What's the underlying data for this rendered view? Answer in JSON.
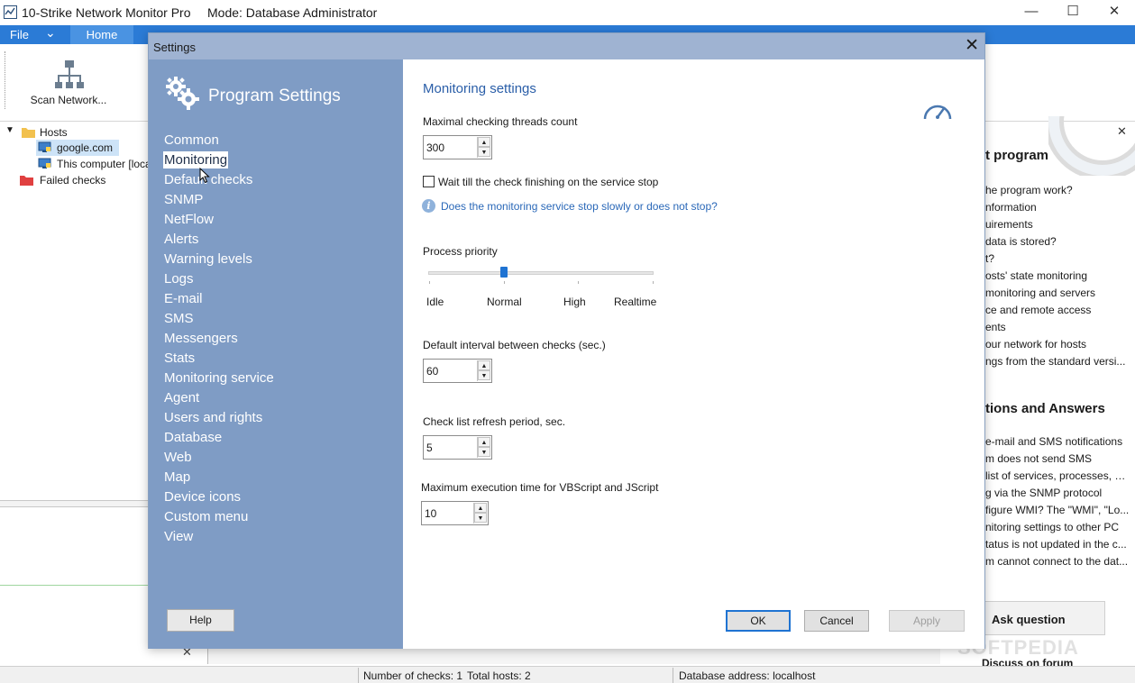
{
  "window": {
    "title": "10-Strike Network Monitor Pro",
    "mode": "Mode: Database Administrator",
    "controls": {
      "minimize": "—",
      "maximize": "☐",
      "close": "✕"
    }
  },
  "menu": {
    "file": "File",
    "dropdown": "⌄",
    "home": "Home"
  },
  "ribbon": {
    "scan_label": "Scan Network..."
  },
  "tree": {
    "root": "Hosts",
    "items": [
      "google.com",
      "This computer [loca",
      "Failed checks"
    ]
  },
  "status": {
    "checks": "Number of checks: 1",
    "hosts": "Total hosts: 2",
    "db": "Database address: localhost"
  },
  "help_panel": {
    "heading1": "t program",
    "links1": [
      "he program work?",
      "nformation",
      "uirements",
      "data is stored?",
      "t?",
      "osts' state monitoring",
      "monitoring and servers",
      "ce and remote access",
      "ents",
      "our network for hosts",
      "ngs from the standard versi..."
    ],
    "heading2": "tions and Answers",
    "links2": [
      "e-mail and SMS notifications",
      "m does not send SMS",
      " list of services, processes, a...",
      "g via the SNMP protocol",
      "figure WMI? The \"WMI\", \"Lo...",
      "nitoring settings to other PC",
      "tatus is not updated in the c...",
      "m cannot connect to the dat..."
    ],
    "ask_button": "Ask question",
    "discuss": "Discuss on forum",
    "close": "✕"
  },
  "watermark": "SOFTPEDIA",
  "dialog": {
    "title": "Settings",
    "close": "✕",
    "heading": "Program Settings",
    "nav": [
      "Common",
      "Monitoring",
      "Default checks",
      "SNMP",
      "NetFlow",
      "Alerts",
      "Warning levels",
      "Logs",
      "E-mail",
      "SMS",
      "Messengers",
      "Stats",
      "Monitoring service",
      "Agent",
      "Users and rights",
      "Database",
      "Web",
      "Map",
      "Device icons",
      "Custom menu",
      "View"
    ],
    "active_nav": "Monitoring",
    "help_button": "Help",
    "content": {
      "section_title": "Monitoring settings",
      "threads_label": "Maximal checking threads count",
      "threads_value": "300",
      "wait_checkbox_label": "Wait till the check finishing on the service stop",
      "wait_checked": false,
      "info_link": "Does the monitoring service stop slowly or does not stop?",
      "priority_label": "Process priority",
      "priority_levels": [
        "Idle",
        "Normal",
        "High",
        "Realtime"
      ],
      "priority_selected": "Normal",
      "interval_label": "Default interval between checks (sec.)",
      "interval_value": "60",
      "refresh_label": "Check list refresh period, sec.",
      "refresh_value": "5",
      "exec_label": "Maximum execution time for VBScript and JScript",
      "exec_value": "10"
    },
    "buttons": {
      "ok": "OK",
      "cancel": "Cancel",
      "apply": "Apply"
    }
  },
  "colors": {
    "menubar": "#2b7bd6",
    "dialog_sidebar": "#7f9cc5",
    "dialog_titlebar": "#9fb3d2",
    "section_title": "#2a5ea8",
    "link": "#2a68b8"
  }
}
